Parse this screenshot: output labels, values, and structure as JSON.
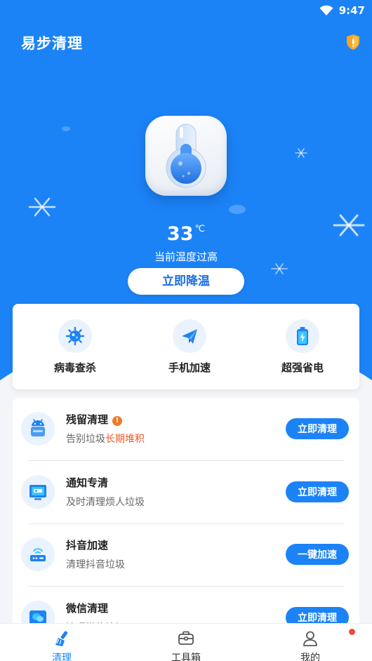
{
  "status_bar": {
    "time": "9:47",
    "wifi_icon": "wifi-icon"
  },
  "header": {
    "title": "易步清理",
    "badge_icon": "shield-alert-icon"
  },
  "temperature": {
    "value": "33",
    "unit": "℃",
    "status_text": "当前温度过高",
    "cool_button": "立即降温",
    "icon": "thermometer-icon"
  },
  "quick_actions": [
    {
      "label": "病毒查杀",
      "icon": "virus-icon"
    },
    {
      "label": "手机加速",
      "icon": "paper-plane-icon"
    },
    {
      "label": "超强省电",
      "icon": "battery-icon"
    }
  ],
  "features": [
    {
      "title": "残留清理",
      "alert": "!",
      "subtitle_prefix": "告别垃圾",
      "subtitle_highlight": "长期堆积",
      "button": "立即清理",
      "icon": "android-icon"
    },
    {
      "title": "通知专清",
      "subtitle_prefix": "及时清理烦人垃圾",
      "subtitle_highlight": "",
      "button": "立即清理",
      "icon": "notification-icon"
    },
    {
      "title": "抖音加速",
      "subtitle_prefix": "清理抖音垃圾",
      "subtitle_highlight": "",
      "button": "一键加速",
      "icon": "router-icon"
    },
    {
      "title": "微信清理",
      "subtitle_prefix": "清理微信垃圾",
      "subtitle_highlight": "",
      "button": "立即清理",
      "icon": "wechat-icon"
    }
  ],
  "tabs": [
    {
      "label": "清理",
      "icon": "broom-icon",
      "active": true
    },
    {
      "label": "工具箱",
      "icon": "toolbox-icon",
      "active": false
    },
    {
      "label": "我的",
      "icon": "user-icon",
      "active": false,
      "has_notification": true
    }
  ],
  "colors": {
    "primary": "#1c83f7",
    "highlight": "#f05a28",
    "notify": "#f04a3e"
  }
}
